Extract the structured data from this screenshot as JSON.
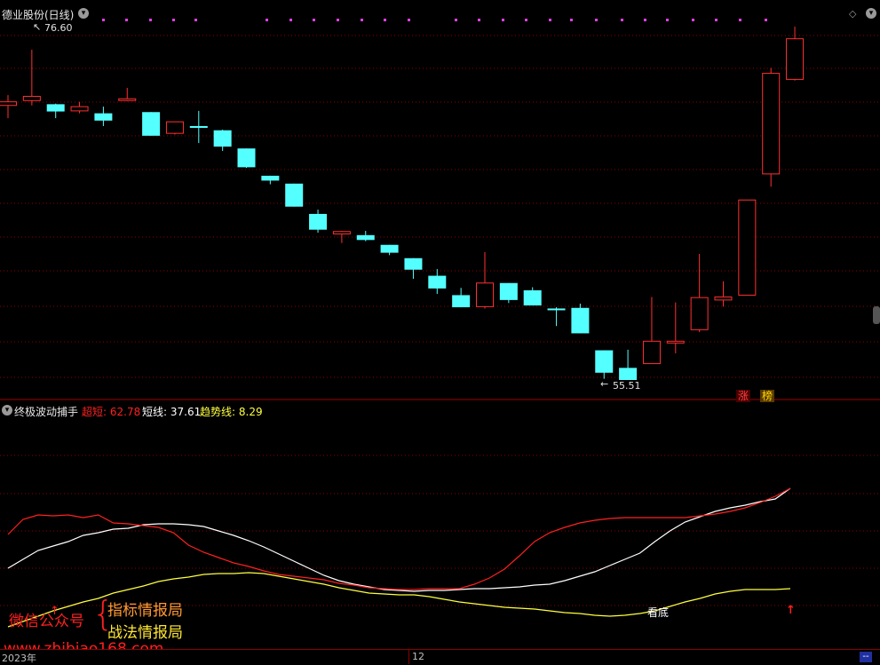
{
  "main_panel": {
    "title": "德业股份(日线)",
    "max_price_label": "76.60",
    "min_price_label": "55.51",
    "badges": [
      "涨",
      "榜"
    ]
  },
  "indicator_panel": {
    "title": "终极波动捕手",
    "lines": [
      {
        "label": "超短:",
        "value": "62.78",
        "color": "#ff2020"
      },
      {
        "label": "短线:",
        "value": "37.61",
        "color": "#ffffff"
      },
      {
        "label": "趋势线:",
        "value": "8.29",
        "color": "#ffff40"
      }
    ],
    "signal_text": "看底"
  },
  "watermark": {
    "wechat": "微信公众号",
    "line1": "指标情报局",
    "line2": "战法情报局",
    "site": "www.zhibiao168.com"
  },
  "bottom_bar": {
    "year_label": "2023年",
    "month_label": "12"
  },
  "colors": {
    "up": "#ff3030",
    "down": "#54ffff",
    "grid": "#8b0000",
    "background": "#000000"
  },
  "candles": [
    {
      "o": 66.6,
      "c": 67.2,
      "h": 68.3,
      "l": 64.5
    },
    {
      "o": 67.4,
      "c": 68.1,
      "h": 75.8,
      "l": 66.6
    },
    {
      "o": 66.8,
      "c": 65.6,
      "h": 66.9,
      "l": 64.5
    },
    {
      "o": 65.7,
      "c": 66.4,
      "h": 67.2,
      "l": 65.3
    },
    {
      "o": 65.3,
      "c": 64.1,
      "h": 66.4,
      "l": 63.2
    },
    {
      "o": 67.7,
      "c": 67.7,
      "h": 69.5,
      "l": 67.3
    },
    {
      "o": 65.5,
      "c": 61.6,
      "h": 65.5,
      "l": 61.6
    },
    {
      "o": 62.0,
      "c": 63.9,
      "h": 63.9,
      "l": 61.8
    },
    {
      "o": 63.2,
      "c": 62.9,
      "h": 65.7,
      "l": 60.4
    },
    {
      "o": 62.5,
      "c": 59.8,
      "h": 62.6,
      "l": 59.1
    },
    {
      "o": 59.5,
      "c": 56.4,
      "h": 59.5,
      "l": 56.3
    },
    {
      "o": 55.0,
      "c": 54.2,
      "h": 55.0,
      "l": 53.6
    },
    {
      "o": 53.7,
      "c": 49.9,
      "h": 53.7,
      "l": 49.9
    },
    {
      "o": 48.7,
      "c": 46.1,
      "h": 49.4,
      "l": 45.6
    },
    {
      "o": 45.4,
      "c": 45.8,
      "h": 45.9,
      "l": 43.9
    },
    {
      "o": 45.2,
      "c": 44.4,
      "h": 45.9,
      "l": 44.2
    },
    {
      "o": 43.6,
      "c": 42.3,
      "h": 43.6,
      "l": 41.9
    },
    {
      "o": 41.4,
      "c": 39.5,
      "h": 41.4,
      "l": 38.0
    },
    {
      "o": 38.5,
      "c": 36.4,
      "h": 39.6,
      "l": 35.5
    },
    {
      "o": 35.3,
      "c": 33.3,
      "h": 36.5,
      "l": 33.3
    },
    {
      "o": 33.4,
      "c": 37.3,
      "h": 42.4,
      "l": 33.1
    },
    {
      "o": 37.3,
      "c": 34.5,
      "h": 37.3,
      "l": 34.0
    },
    {
      "o": 36.1,
      "c": 33.6,
      "h": 36.6,
      "l": 33.6
    },
    {
      "o": 33.1,
      "c": 32.9,
      "h": 33.3,
      "l": 30.2
    },
    {
      "o": 33.2,
      "c": 29.0,
      "h": 33.9,
      "l": 29.0
    },
    {
      "o": 26.2,
      "c": 22.5,
      "h": 26.2,
      "l": 21.5
    },
    {
      "o": 23.3,
      "c": 21.3,
      "h": 26.3,
      "l": 21.3
    },
    {
      "o": 24.0,
      "c": 27.7,
      "h": 35.0,
      "l": 24.0
    },
    {
      "o": 27.7,
      "c": 27.7,
      "h": 34.1,
      "l": 25.7
    },
    {
      "o": 29.6,
      "c": 34.9,
      "h": 42.1,
      "l": 29.2
    },
    {
      "o": 34.5,
      "c": 35.0,
      "h": 37.6,
      "l": 33.4
    },
    {
      "o": 35.3,
      "c": 51.0,
      "h": 51.0,
      "l": 35.3
    },
    {
      "o": 55.3,
      "c": 71.9,
      "h": 72.8,
      "l": 53.2
    },
    {
      "o": 70.9,
      "c": 77.6,
      "h": 79.6,
      "l": 70.7
    }
  ],
  "indicator_series": {
    "red": [
      52,
      35,
      30,
      31,
      30,
      33,
      30,
      39,
      40,
      42,
      44,
      50,
      64,
      72,
      78,
      84,
      88,
      93,
      97,
      99,
      101,
      103,
      107,
      109,
      112,
      113,
      114,
      114,
      113,
      113,
      113,
      108,
      101,
      91,
      76,
      60,
      50,
      44,
      39,
      36,
      34,
      33,
      33,
      33,
      33,
      33,
      31,
      29,
      26,
      22,
      16,
      9,
      0
    ],
    "white": [
      90,
      80,
      70,
      65,
      60,
      53,
      50,
      46,
      45,
      41,
      40,
      40,
      41,
      43,
      48,
      53,
      59,
      66,
      74,
      82,
      90,
      98,
      104,
      108,
      111,
      114,
      115,
      116,
      115,
      115,
      114,
      113,
      113,
      112,
      111,
      109,
      108,
      104,
      99,
      94,
      87,
      80,
      73,
      60,
      48,
      38,
      32,
      26,
      22,
      19,
      15,
      12,
      0
    ],
    "yellow": [
      156,
      150,
      144,
      138,
      133,
      128,
      124,
      118,
      114,
      110,
      105,
      102,
      100,
      97,
      96,
      96,
      95,
      96,
      99,
      102,
      105,
      108,
      112,
      115,
      118,
      119,
      120,
      120,
      122,
      125,
      128,
      130,
      132,
      134,
      135,
      136,
      138,
      140,
      141,
      143,
      144,
      143,
      141,
      138,
      133,
      128,
      124,
      119,
      116,
      114,
      114,
      114,
      113
    ]
  }
}
